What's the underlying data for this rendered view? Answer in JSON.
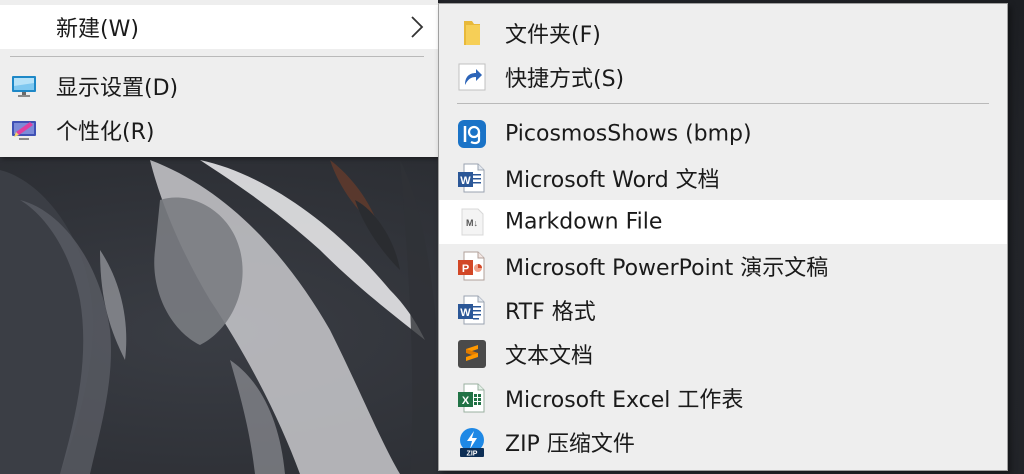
{
  "main_menu": {
    "items": [
      {
        "label": "新建(W)",
        "icon": "chevron-right-icon"
      },
      {
        "label": "显示设置(D)",
        "icon": "display-settings-icon"
      },
      {
        "label": "个性化(R)",
        "icon": "personalize-icon"
      }
    ]
  },
  "new_submenu": {
    "items": [
      {
        "label": "文件夹(F)",
        "icon": "folder-icon"
      },
      {
        "label": "快捷方式(S)",
        "icon": "shortcut-icon"
      },
      {
        "label": "PicosmosShows (bmp)",
        "icon": "picosmos-icon"
      },
      {
        "label": "Microsoft Word 文档",
        "icon": "word-icon"
      },
      {
        "label": "Markdown File",
        "icon": "markdown-icon"
      },
      {
        "label": "Microsoft PowerPoint 演示文稿",
        "icon": "powerpoint-icon"
      },
      {
        "label": "RTF 格式",
        "icon": "rtf-icon"
      },
      {
        "label": "文本文档",
        "icon": "sublime-text-icon"
      },
      {
        "label": "Microsoft Excel 工作表",
        "icon": "excel-icon"
      },
      {
        "label": "ZIP 压缩文件",
        "icon": "zip-icon"
      }
    ],
    "hovered": "Markdown File"
  },
  "colors": {
    "menu_bg": "#eeeeee",
    "hover_bg": "#ffffff",
    "separator": "#b9b9b9",
    "word_blue": "#2b5797",
    "ppt_orange": "#d24726",
    "excel_green": "#217346",
    "folder_yellow": "#f4c542",
    "picosmos_blue": "#1a73c7",
    "zip_blue": "#1e88e5",
    "sublime_orange": "#ff9800"
  }
}
